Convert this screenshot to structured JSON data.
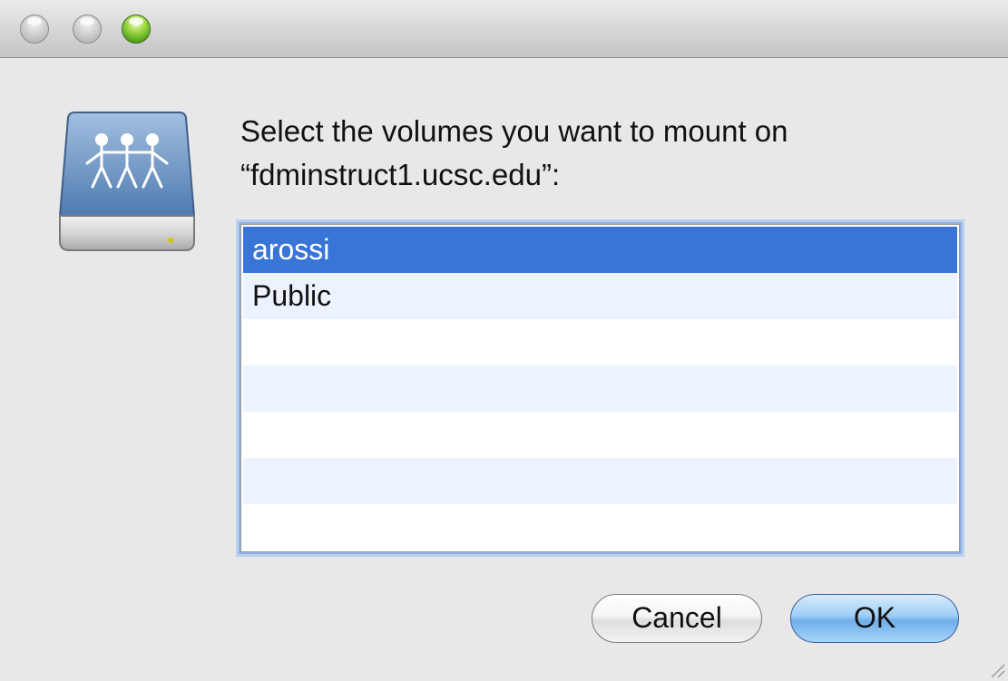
{
  "window": {
    "controls": [
      "close",
      "minimize",
      "zoom"
    ]
  },
  "dialog": {
    "icon": "network-server-icon",
    "prompt_line1": "Select the volumes you want to mount on",
    "prompt_line2": "“fdminstruct1.ucsc.edu”:",
    "volumes": [
      {
        "label": "arossi",
        "selected": true
      },
      {
        "label": "Public",
        "selected": false
      }
    ],
    "cancel_label": "Cancel",
    "ok_label": "OK"
  },
  "colors": {
    "selection": "#3875d7",
    "zebra_row": "#edf3fe",
    "window_bg": "#e8e8e8"
  }
}
